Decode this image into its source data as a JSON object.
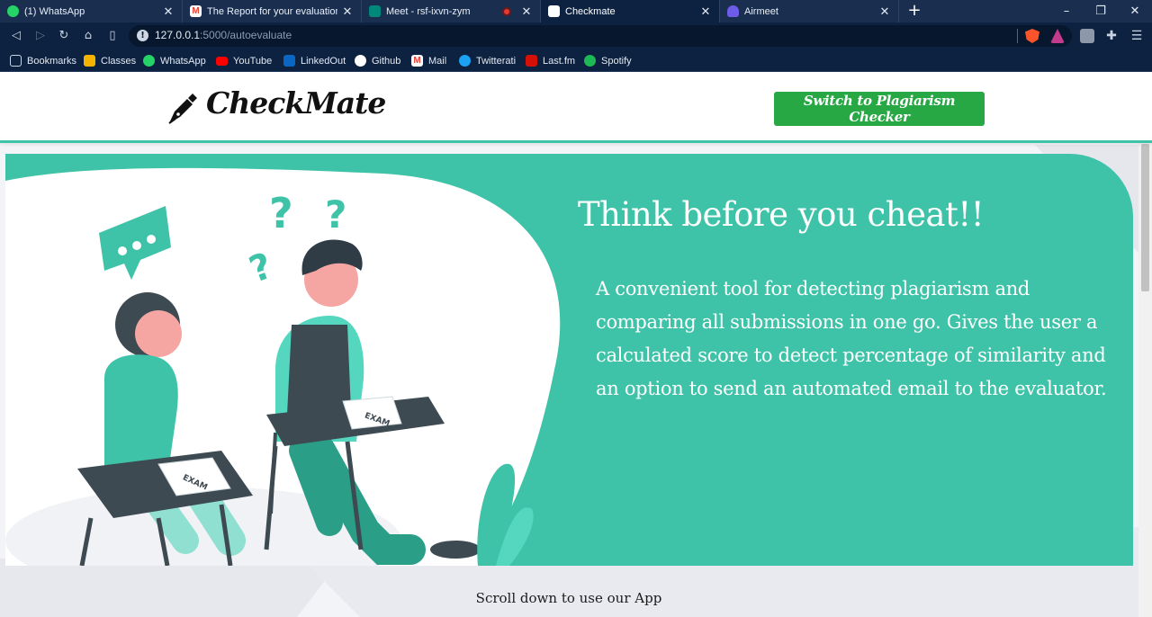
{
  "browser": {
    "tabs": [
      {
        "title": "(1) WhatsApp",
        "icon": "whatsapp-icon",
        "color": "#25d366",
        "active": false
      },
      {
        "title": "The Report for your evaluation is h",
        "icon": "gmail-icon",
        "color": "#ea4335",
        "active": false
      },
      {
        "title": "Meet - rsf-ixvn-zym",
        "icon": "google-meet-icon",
        "color": "#00897b",
        "active": false
      },
      {
        "title": "Checkmate",
        "icon": "checkmate-icon",
        "color": "#ffffff",
        "active": true
      },
      {
        "title": "Airmeet",
        "icon": "airmeet-icon",
        "color": "#6c5ce7",
        "active": false
      }
    ],
    "new_tab": "+",
    "window_controls": {
      "minimize": "–",
      "maximize": "❐",
      "close": "✕"
    },
    "url_host": "127.0.0.1",
    "url_path": ":5000/autoevaluate",
    "bookmarks": [
      {
        "label": "Bookmarks",
        "icon": "bookmarks-icon",
        "color": "#c9d4e3"
      },
      {
        "label": "Classes",
        "icon": "classroom-icon",
        "color": "#f4b400"
      },
      {
        "label": "WhatsApp",
        "icon": "whatsapp-icon",
        "color": "#25d366"
      },
      {
        "label": "YouTube",
        "icon": "youtube-icon",
        "color": "#ff0000"
      },
      {
        "label": "LinkedOut",
        "icon": "linkedin-icon",
        "color": "#0a66c2"
      },
      {
        "label": "Github",
        "icon": "github-icon",
        "color": "#ffffff"
      },
      {
        "label": "Mail",
        "icon": "gmail-icon",
        "color": "#ea4335"
      },
      {
        "label": "Twitterati",
        "icon": "twitter-icon",
        "color": "#1da1f2"
      },
      {
        "label": "Last.fm",
        "icon": "lastfm-icon",
        "color": "#d51007"
      },
      {
        "label": "Spotify",
        "icon": "spotify-icon",
        "color": "#1db954"
      }
    ]
  },
  "page": {
    "logo_text": "CheckMate",
    "switch_button": "Switch to Plagiarism Checker",
    "hero_title": "Think before you cheat!!",
    "hero_description": "A convenient tool for detecting plagiarism and comparing all submissions in one go. Gives the user a calculated score to detect percentage of similarity and an option to send an automated email to the evaluator.",
    "scroll_hint": "Scroll down to use our App",
    "accent_color": "#3ec3a8",
    "button_color": "#28a745",
    "illustration_labels": [
      "EXAM",
      "EXAM"
    ]
  }
}
